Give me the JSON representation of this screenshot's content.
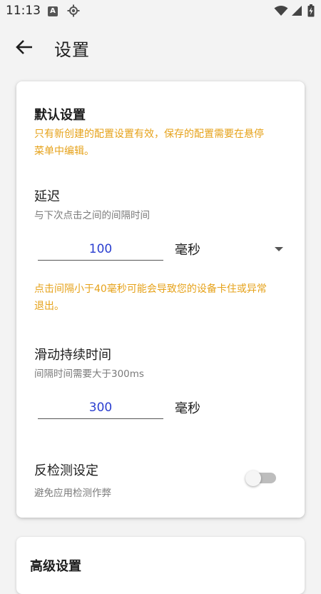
{
  "status": {
    "time": "11:13",
    "notification_icon_letter": "A"
  },
  "header": {
    "title": "设置"
  },
  "default_settings": {
    "title": "默认设置",
    "warning_line1": "只有新创建的配置设置有效，保存的配置需要在悬停",
    "warning_line2": "菜单中编辑。",
    "delay": {
      "label": "延迟",
      "description": "与下次点击之间的间隔时间",
      "value": "100",
      "unit": "毫秒",
      "warning_line1": "点击间隔小于40毫秒可能会导致您的设备卡住或异常",
      "warning_line2": "退出。"
    },
    "swipe": {
      "label": "滑动持续时间",
      "description": "间隔时间需要大于300ms",
      "value": "300",
      "unit": "毫秒"
    },
    "anti_detect": {
      "label": "反检测设定",
      "description": "避免应用检测作弊",
      "enabled": false
    }
  },
  "advanced_settings": {
    "title": "高级设置"
  },
  "colors": {
    "warning": "#e6a21a",
    "value_text": "#2b3fd0",
    "background": "#f3f3f3"
  },
  "icons": {
    "back": "arrow-left-icon",
    "dropdown": "triangle-down-icon",
    "gps": "gps-icon",
    "wifi": "wifi-icon",
    "signal": "signal-icon",
    "battery": "battery-charging-icon"
  }
}
